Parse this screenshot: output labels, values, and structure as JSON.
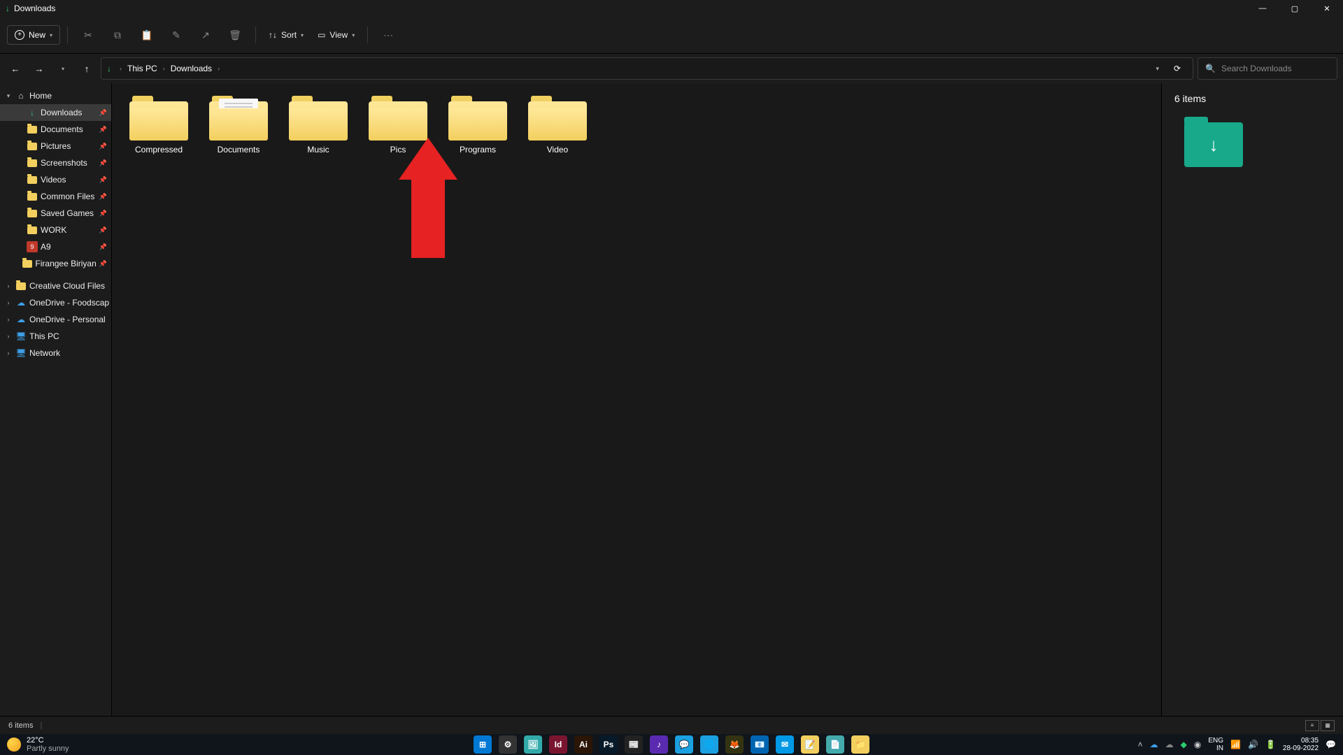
{
  "title": "Downloads",
  "toolbar": {
    "new_label": "New",
    "sort_label": "Sort",
    "view_label": "View"
  },
  "breadcrumb": [
    "This PC",
    "Downloads"
  ],
  "search_placeholder": "Search Downloads",
  "sidebar": {
    "home": "Home",
    "quick": [
      {
        "label": "Downloads",
        "pin": true,
        "icon": "dl",
        "sel": true
      },
      {
        "label": "Documents",
        "pin": true,
        "icon": "folder"
      },
      {
        "label": "Pictures",
        "pin": true,
        "icon": "folder"
      },
      {
        "label": "Screenshots",
        "pin": true,
        "icon": "folder"
      },
      {
        "label": "Videos",
        "pin": true,
        "icon": "folder"
      },
      {
        "label": "Common Files",
        "pin": true,
        "icon": "folder"
      },
      {
        "label": "Saved Games",
        "pin": true,
        "icon": "folder"
      },
      {
        "label": "WORK",
        "pin": true,
        "icon": "folder"
      },
      {
        "label": "A9",
        "pin": true,
        "icon": "app"
      },
      {
        "label": "Firangee Biriyan",
        "pin": true,
        "icon": "folder"
      }
    ],
    "roots": [
      {
        "label": "Creative Cloud Files",
        "icon": "folder"
      },
      {
        "label": "OneDrive - Foodscap",
        "icon": "cloud"
      },
      {
        "label": "OneDrive - Personal",
        "icon": "cloud"
      },
      {
        "label": "This PC",
        "icon": "pc"
      },
      {
        "label": "Network",
        "icon": "pc"
      }
    ]
  },
  "folders": [
    "Compressed",
    "Documents",
    "Music",
    "Pics",
    "Programs",
    "Video"
  ],
  "details": {
    "count": "6 items"
  },
  "status": {
    "count": "6 items"
  },
  "taskbar": {
    "temp": "22°C",
    "weather": "Partly sunny",
    "lang1": "ENG",
    "lang2": "IN",
    "time": "08:35",
    "date": "28-09-2022",
    "apps": [
      {
        "bg": "#0078d4",
        "txt": "⊞"
      },
      {
        "bg": "#333",
        "txt": "⚙"
      },
      {
        "bg": "#3aa",
        "txt": "🖼"
      },
      {
        "bg": "#7a1530",
        "txt": "Id"
      },
      {
        "bg": "#2a1506",
        "txt": "Ai"
      },
      {
        "bg": "#071a2a",
        "txt": "Ps"
      },
      {
        "bg": "#222",
        "txt": "📰"
      },
      {
        "bg": "#5a2bb0",
        "txt": "♪"
      },
      {
        "bg": "#1ba0e2",
        "txt": "💬"
      },
      {
        "bg": "#1ba0e2",
        "txt": "🌐"
      },
      {
        "bg": "#331",
        "txt": "🦊"
      },
      {
        "bg": "#0064b0",
        "txt": "📧"
      },
      {
        "bg": "#0099e5",
        "txt": "✉"
      },
      {
        "bg": "#f2cf5e",
        "txt": "📝"
      },
      {
        "bg": "#4aa",
        "txt": "📄"
      },
      {
        "bg": "#f2cf5e",
        "txt": "📁"
      }
    ]
  }
}
